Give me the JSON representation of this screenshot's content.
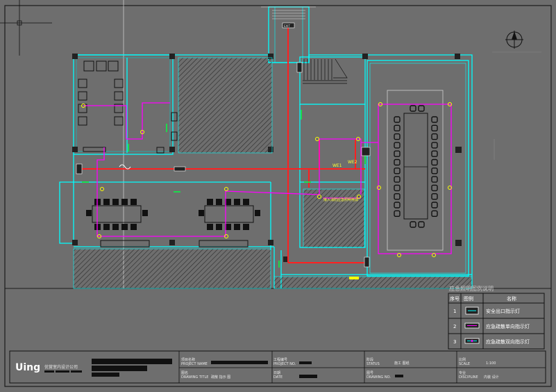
{
  "plan": {
    "exit_sign_label": "EXIT",
    "route_labels": [
      "WE1",
      "WE2"
    ],
    "note_label": "接入消防应急照明电源"
  },
  "legend": {
    "title": "应急照明图例说明",
    "headers": [
      "序号",
      "图例",
      "名称"
    ],
    "rows": [
      {
        "no": "1",
        "icon": "exit-sign-icon",
        "name": "安全出口指示灯"
      },
      {
        "no": "2",
        "icon": "one-way-arrow-icon",
        "name": "应急疏散单向指示灯"
      },
      {
        "no": "3",
        "icon": "two-way-arrow-icon",
        "name": "应急疏散双向指示灯"
      }
    ]
  },
  "title_block": {
    "logo": "Uing",
    "company": "优营室内设计公司",
    "project_name_label": "项目名称",
    "project_name_en": "PROJECT NAME",
    "drawing_title_label": "图名",
    "drawing_title_en": "DRAWING TITLE",
    "drawing_title_value": "疏散 指示 图",
    "project_no_label": "工程编号",
    "project_no_en": "PROJECT NO.",
    "date_label": "日期",
    "date_en": "DATE",
    "status_label": "阶段",
    "status_en": "STATUS",
    "status_value": "施工 图纸",
    "drawing_no_label": "图号",
    "drawing_no_en": "DRAWING NO.",
    "scale_label": "比例",
    "scale_en": "SCALE",
    "scale_value": "1:100",
    "discipline_label": "专业",
    "discipline_en": "DISCIPLINE",
    "discipline_value": "内装 设计"
  },
  "colors": {
    "background": "#6e6e6e",
    "wall": "#00ffff",
    "route_red": "#ff2020",
    "route_magenta": "#ff00ff",
    "fixture": "#ffff00",
    "furniture": "#000000"
  }
}
